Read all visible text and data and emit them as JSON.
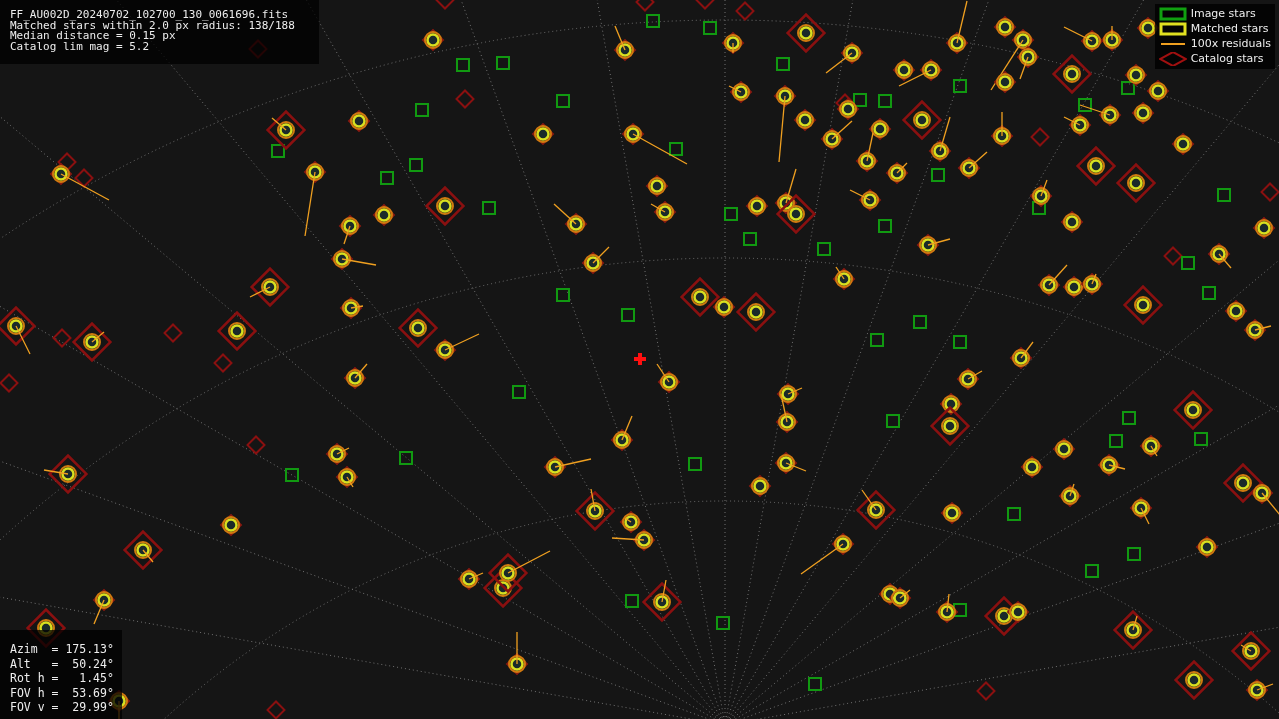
{
  "info_box": {
    "lines": [
      "FF_AU002D_20240702_102700_130_0061696.fits",
      "Matched stars within 2.0 px radius: 138/188",
      "Median distance = 0.15 px",
      "Catalog lim mag = 5.2"
    ]
  },
  "legend": {
    "items": [
      {
        "kind": "image",
        "label": "Image stars",
        "color": "#10a010"
      },
      {
        "kind": "matched",
        "label": "Matched stars",
        "color": "#e0e020"
      },
      {
        "kind": "residual",
        "label": "100x residuals",
        "color": "#f0a020"
      },
      {
        "kind": "catalog",
        "label": "Catalog stars",
        "color": "#a01010"
      }
    ]
  },
  "pointing_box": {
    "lines": [
      "Azim  = 175.13°",
      "Alt   =  50.24°",
      "Rot h =   1.45°",
      "FOV h =  53.69°",
      "FOV v =  29.99°"
    ]
  }
}
